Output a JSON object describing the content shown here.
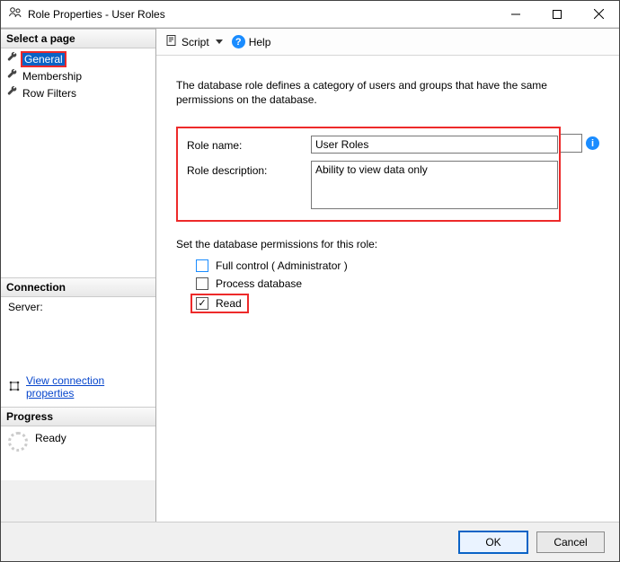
{
  "window": {
    "title": "Role Properties - User Roles"
  },
  "sidebar": {
    "select_header": "Select a page",
    "pages": [
      {
        "label": "General",
        "selected": true
      },
      {
        "label": "Membership",
        "selected": false
      },
      {
        "label": "Row Filters",
        "selected": false
      }
    ],
    "connection_header": "Connection",
    "server_label": "Server:",
    "view_conn_link": "View connection properties",
    "progress_header": "Progress",
    "progress_status": "Ready"
  },
  "toolbar": {
    "script_label": "Script",
    "help_label": "Help"
  },
  "content": {
    "description": "The database role defines a category of users and groups that have the same permissions on the database.",
    "role_name_label": "Role name:",
    "role_name_value": "User Roles",
    "role_desc_label": "Role description:",
    "role_desc_value": "Ability to view data only",
    "perm_title": "Set the database permissions for this role:",
    "perm_full": "Full control ( Administrator )",
    "perm_process": "Process database",
    "perm_read": "Read"
  },
  "footer": {
    "ok": "OK",
    "cancel": "Cancel"
  },
  "colors": {
    "highlight": "#ed2a2a",
    "accent": "#0a63c6"
  }
}
